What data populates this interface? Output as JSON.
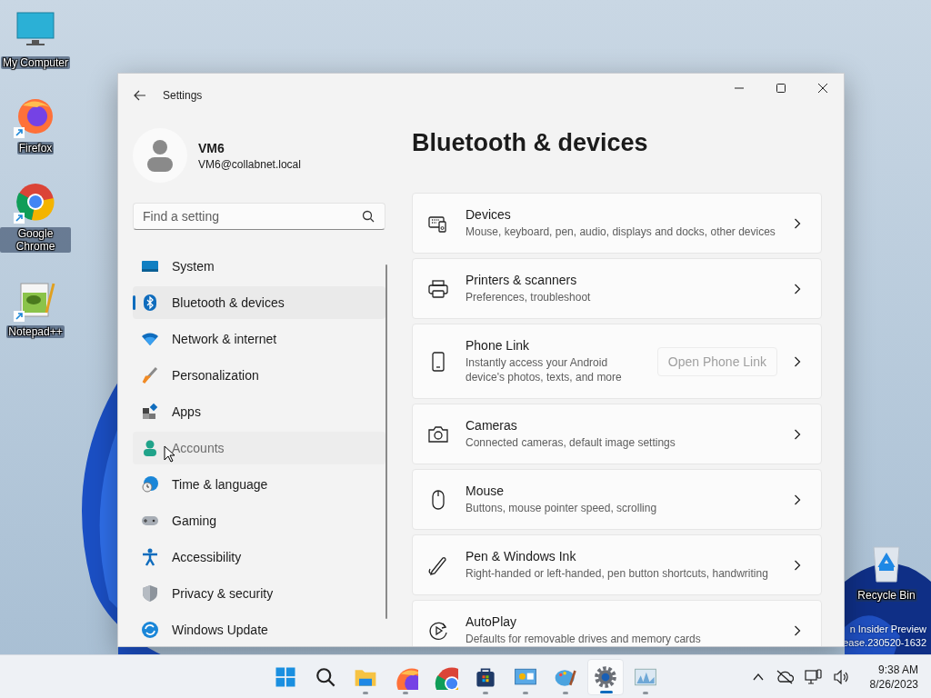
{
  "desktop": {
    "icons": [
      {
        "label": "My Computer",
        "kind": "computer",
        "shortcut": false
      },
      {
        "label": "Firefox",
        "kind": "firefox",
        "shortcut": true
      },
      {
        "label": "Google Chrome",
        "kind": "chrome",
        "shortcut": true
      },
      {
        "label": "Notepad++",
        "kind": "notepad",
        "shortcut": true
      }
    ],
    "recycle_bin": {
      "label": "Recycle Bin"
    },
    "watermark_lines": [
      "n Insider Preview",
      "ease.230520-1632"
    ]
  },
  "window": {
    "title": "Settings"
  },
  "profile": {
    "name": "VM6",
    "email": "VM6@collabnet.local"
  },
  "search": {
    "placeholder": "Find a setting"
  },
  "nav": [
    {
      "label": "System",
      "kind": "system",
      "selected": false,
      "hovered": false
    },
    {
      "label": "Bluetooth & devices",
      "kind": "bluetooth",
      "selected": true,
      "hovered": false
    },
    {
      "label": "Network & internet",
      "kind": "network",
      "selected": false,
      "hovered": false
    },
    {
      "label": "Personalization",
      "kind": "brush",
      "selected": false,
      "hovered": false
    },
    {
      "label": "Apps",
      "kind": "apps",
      "selected": false,
      "hovered": false
    },
    {
      "label": "Accounts",
      "kind": "accounts",
      "selected": false,
      "hovered": true
    },
    {
      "label": "Time & language",
      "kind": "time",
      "selected": false,
      "hovered": false
    },
    {
      "label": "Gaming",
      "kind": "gaming",
      "selected": false,
      "hovered": false
    },
    {
      "label": "Accessibility",
      "kind": "accessibility",
      "selected": false,
      "hovered": false
    },
    {
      "label": "Privacy & security",
      "kind": "privacy",
      "selected": false,
      "hovered": false
    },
    {
      "label": "Windows Update",
      "kind": "update",
      "selected": false,
      "hovered": false
    }
  ],
  "page_title": "Bluetooth & devices",
  "cards": [
    {
      "title": "Devices",
      "description": "Mouse, keyboard, pen, audio, displays and docks, other devices",
      "kind": "devices"
    },
    {
      "title": "Printers & scanners",
      "description": "Preferences, troubleshoot",
      "kind": "printer"
    },
    {
      "title": "Phone Link",
      "description": "Instantly access your Android device's photos, texts, and more",
      "kind": "phone",
      "button": {
        "label": "Open Phone Link",
        "disabled": true
      }
    },
    {
      "title": "Cameras",
      "description": "Connected cameras, default image settings",
      "kind": "camera"
    },
    {
      "title": "Mouse",
      "description": "Buttons, mouse pointer speed, scrolling",
      "kind": "mouse"
    },
    {
      "title": "Pen & Windows Ink",
      "description": "Right-handed or left-handed, pen button shortcuts, handwriting",
      "kind": "pen"
    },
    {
      "title": "AutoPlay",
      "description": "Defaults for removable drives and memory cards",
      "kind": "autoplay"
    }
  ],
  "taskbar": {
    "apps": [
      {
        "kind": "start",
        "running": false,
        "selected": false
      },
      {
        "kind": "search",
        "running": false,
        "selected": false
      },
      {
        "kind": "folder",
        "running": true,
        "selected": false
      },
      {
        "kind": "firefox",
        "running": true,
        "selected": false
      },
      {
        "kind": "chrome",
        "running": false,
        "selected": false
      },
      {
        "kind": "store",
        "running": true,
        "selected": false
      },
      {
        "kind": "remote",
        "running": true,
        "selected": false
      },
      {
        "kind": "paint",
        "running": true,
        "selected": false
      },
      {
        "kind": "settings",
        "running": true,
        "selected": true
      },
      {
        "kind": "monitor",
        "running": true,
        "selected": false
      }
    ],
    "clock": {
      "time": "9:38 AM",
      "date": "8/26/2023"
    }
  }
}
